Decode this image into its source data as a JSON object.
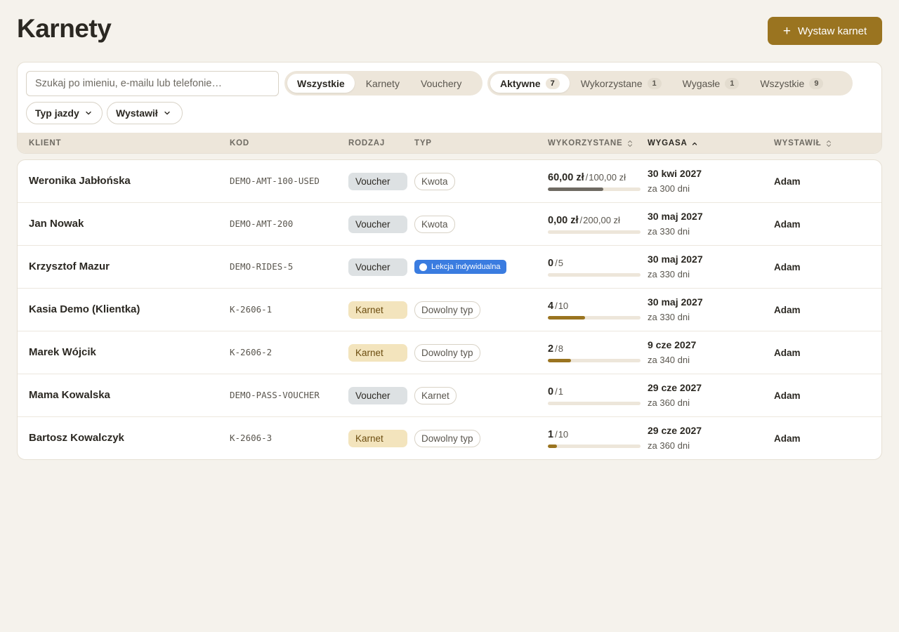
{
  "page": {
    "title": "Karnety",
    "new_button_label": "Wystaw karnet"
  },
  "filters": {
    "search_placeholder": "Szukaj po imieniu, e-mailu lub telefonie…",
    "kind": [
      {
        "label": "Wszystkie",
        "active": true
      },
      {
        "label": "Karnety",
        "active": false
      },
      {
        "label": "Vouchery",
        "active": false
      }
    ],
    "status": [
      {
        "label": "Aktywne",
        "count": "7",
        "active": true
      },
      {
        "label": "Wykorzystane",
        "count": "1",
        "active": false
      },
      {
        "label": "Wygasłe",
        "count": "1",
        "active": false
      },
      {
        "label": "Wszystkie",
        "count": "9",
        "active": false
      }
    ],
    "ride_type_label": "Typ jazdy",
    "issuer_label": "Wystawił"
  },
  "columns": {
    "client": "KLIENT",
    "code": "KOD",
    "kind": "RODZAJ",
    "type": "TYP",
    "used": "WYKORZYSTANE",
    "expires": "WYGASA",
    "issuer": "WYSTAWIŁ"
  },
  "rows": [
    {
      "client": "Weronika Jabłońska",
      "code": "DEMO-AMT-100-USED",
      "kind": "Voucher",
      "kind_style": "voucher",
      "type": "Kwota",
      "type_style": "plain",
      "used": "60,00 zł",
      "total": "100,00 zł",
      "progress": 0.6,
      "expiry_date": "30 kwi 2027",
      "expiry_rel": "za 300 dni",
      "issuer": "Adam"
    },
    {
      "client": "Jan Nowak",
      "code": "DEMO-AMT-200",
      "kind": "Voucher",
      "kind_style": "voucher",
      "type": "Kwota",
      "type_style": "plain",
      "used": "0,00 zł",
      "total": "200,00 zł",
      "progress": 0,
      "expiry_date": "30 maj 2027",
      "expiry_rel": "za 330 dni",
      "issuer": "Adam"
    },
    {
      "client": "Krzysztof Mazur",
      "code": "DEMO-RIDES-5",
      "kind": "Voucher",
      "kind_style": "voucher",
      "type": "Lekcja indywidualna",
      "type_style": "lesson",
      "used": "0",
      "total": "5",
      "progress": 0,
      "expiry_date": "30 maj 2027",
      "expiry_rel": "za 330 dni",
      "issuer": "Adam"
    },
    {
      "client": "Kasia Demo (Klientka)",
      "code": "K-2606-1",
      "kind": "Karnet",
      "kind_style": "karnet",
      "type": "Dowolny typ",
      "type_style": "plain",
      "used": "4",
      "total": "10",
      "progress": 0.4,
      "expiry_date": "30 maj 2027",
      "expiry_rel": "za 330 dni",
      "issuer": "Adam"
    },
    {
      "client": "Marek Wójcik",
      "code": "K-2606-2",
      "kind": "Karnet",
      "kind_style": "karnet",
      "type": "Dowolny typ",
      "type_style": "plain",
      "used": "2",
      "total": "8",
      "progress": 0.25,
      "expiry_date": "9 cze 2027",
      "expiry_rel": "za 340 dni",
      "issuer": "Adam"
    },
    {
      "client": "Mama Kowalska",
      "code": "DEMO-PASS-VOUCHER",
      "kind": "Voucher",
      "kind_style": "voucher",
      "type": "Karnet",
      "type_style": "plain",
      "used": "0",
      "total": "1",
      "progress": 0,
      "expiry_date": "29 cze 2027",
      "expiry_rel": "za 360 dni",
      "issuer": "Adam"
    },
    {
      "client": "Bartosz Kowalczyk",
      "code": "K-2606-3",
      "kind": "Karnet",
      "kind_style": "karnet",
      "type": "Dowolny typ",
      "type_style": "plain",
      "used": "1",
      "total": "10",
      "progress": 0.1,
      "expiry_date": "29 cze 2027",
      "expiry_rel": "za 360 dni",
      "issuer": "Adam"
    }
  ],
  "icons": {
    "new": "plus-icon",
    "dropdown": "chevron-down-icon",
    "sort_both": "sort-icon",
    "sort_asc": "sort-asc-icon"
  },
  "colors": {
    "accent": "#9a7420",
    "background": "#f5f2ec",
    "lesson_badge": "#3a7ce0",
    "voucher_badge": "#dde1e3",
    "karnet_badge": "#f3e4bd"
  }
}
